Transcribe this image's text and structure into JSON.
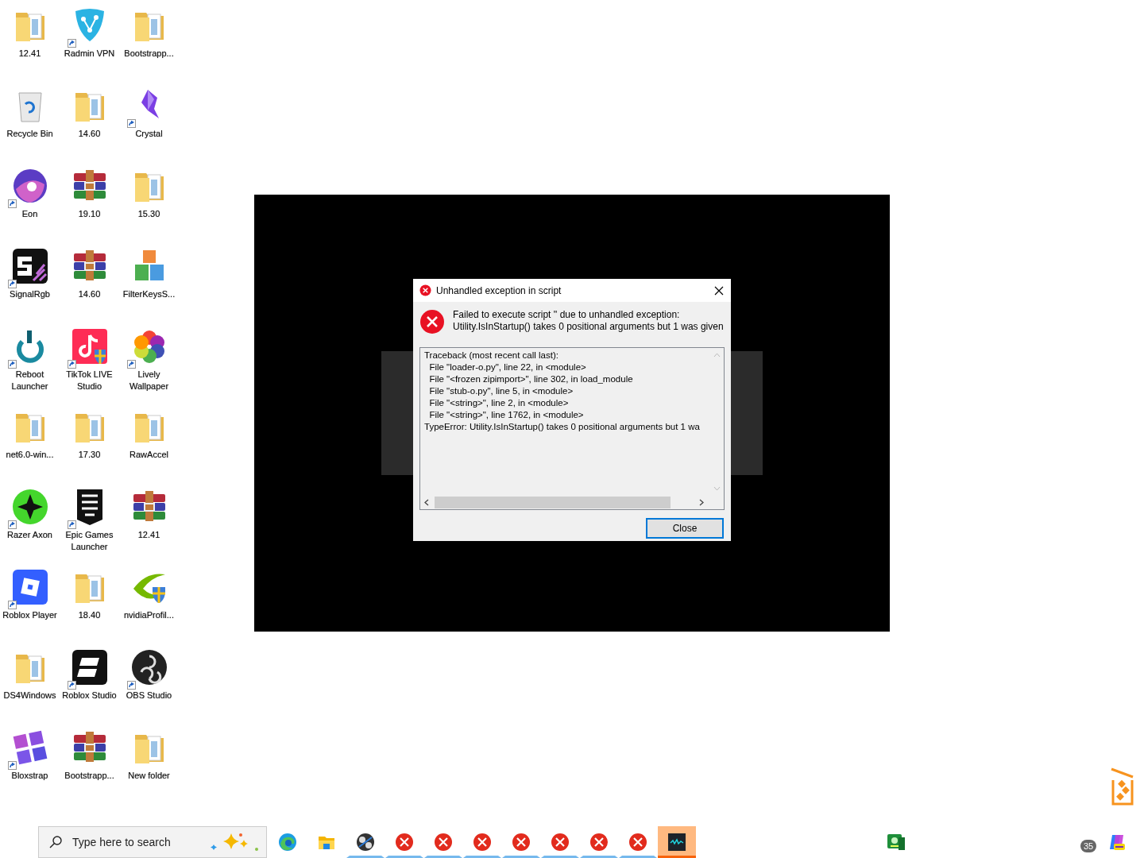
{
  "desktop_icons": [
    {
      "label": "12.41",
      "kind": "folder",
      "shortcut": false
    },
    {
      "label": "Radmin VPN",
      "kind": "vpn",
      "shortcut": true
    },
    {
      "label": "Bootstrapp...",
      "kind": "folder",
      "shortcut": false
    },
    {
      "label": "Recycle Bin",
      "kind": "recycle",
      "shortcut": false
    },
    {
      "label": "14.60",
      "kind": "folder",
      "shortcut": false
    },
    {
      "label": "Crystal",
      "kind": "crystal",
      "shortcut": true
    },
    {
      "label": "Eon",
      "kind": "eon",
      "shortcut": true
    },
    {
      "label": "19.10",
      "kind": "archive",
      "shortcut": false
    },
    {
      "label": "15.30",
      "kind": "folder",
      "shortcut": false
    },
    {
      "label": "SignalRgb",
      "kind": "signalrgb",
      "shortcut": true
    },
    {
      "label": "14.60",
      "kind": "archive",
      "shortcut": false
    },
    {
      "label": "FilterKeysS...",
      "kind": "blocks",
      "shortcut": false
    },
    {
      "label": "Reboot Launcher",
      "kind": "reboot",
      "shortcut": true
    },
    {
      "label": "TikTok LIVE Studio",
      "kind": "tiktok",
      "shortcut": true
    },
    {
      "label": "Lively Wallpaper",
      "kind": "lively",
      "shortcut": true
    },
    {
      "label": "net6.0-win...",
      "kind": "folder",
      "shortcut": false
    },
    {
      "label": "17.30",
      "kind": "folder",
      "shortcut": false
    },
    {
      "label": "RawAccel",
      "kind": "folder",
      "shortcut": false
    },
    {
      "label": "Razer Axon",
      "kind": "razer",
      "shortcut": true
    },
    {
      "label": "Epic Games Launcher",
      "kind": "epic",
      "shortcut": true
    },
    {
      "label": "12.41",
      "kind": "archive",
      "shortcut": false
    },
    {
      "label": "Roblox Player",
      "kind": "roblox",
      "shortcut": true
    },
    {
      "label": "18.40",
      "kind": "folder",
      "shortcut": false
    },
    {
      "label": "nvidiaProfil...",
      "kind": "nvidia",
      "shortcut": false
    },
    {
      "label": "DS4Windows",
      "kind": "folder",
      "shortcut": false
    },
    {
      "label": "Roblox Studio",
      "kind": "robloxstudio",
      "shortcut": true
    },
    {
      "label": "OBS Studio",
      "kind": "obs",
      "shortcut": true
    },
    {
      "label": "Bloxstrap",
      "kind": "bloxstrap",
      "shortcut": true
    },
    {
      "label": "Bootstrapp...",
      "kind": "archive",
      "shortcut": false
    },
    {
      "label": "New folder",
      "kind": "folder",
      "shortcut": false
    }
  ],
  "dialog": {
    "title": "Unhandled exception in script",
    "message": [
      "Failed to execute script '' due to unhandled exception:",
      "Utility.IsInStartup() takes 0 positional arguments but 1 was given"
    ],
    "traceback": [
      "Traceback (most recent call last):",
      "  File \"loader-o.py\", line 22, in <module>",
      "  File \"<frozen zipimport>\", line 302, in load_module",
      "  File \"stub-o.py\", line 5, in <module>",
      "  File \"<string>\", line 2, in <module>",
      "  File \"<string>\", line 1762, in <module>",
      "TypeError: Utility.IsInStartup() takes 0 positional arguments but 1 wa"
    ],
    "button": "Close"
  },
  "taskbar": {
    "search": {
      "placeholder": "Type here to search"
    },
    "apps": [
      {
        "kind": "edge",
        "running": false,
        "selected": false
      },
      {
        "kind": "explorer",
        "running": false,
        "selected": false
      },
      {
        "kind": "media",
        "running": true,
        "selected": false
      },
      {
        "kind": "error",
        "running": true,
        "selected": false
      },
      {
        "kind": "error",
        "running": true,
        "selected": false
      },
      {
        "kind": "error",
        "running": true,
        "selected": false
      },
      {
        "kind": "error",
        "running": true,
        "selected": false
      },
      {
        "kind": "error",
        "running": true,
        "selected": false
      },
      {
        "kind": "error",
        "running": true,
        "selected": false
      },
      {
        "kind": "error",
        "running": true,
        "selected": false
      },
      {
        "kind": "wave",
        "running": true,
        "selected": true
      }
    ],
    "tray_badge": "35"
  }
}
